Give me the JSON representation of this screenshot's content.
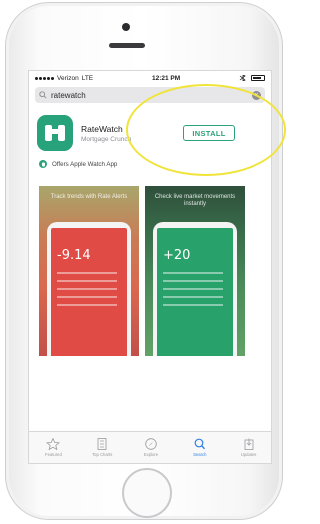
{
  "status_bar": {
    "carrier": "Verizon",
    "network": "LTE",
    "time": "12:21 PM"
  },
  "search": {
    "query": "ratewatch"
  },
  "app": {
    "name": "RateWatch",
    "category": "Mortgage Crunch",
    "install_label": "INSTALL",
    "brand_color": "#28a27a"
  },
  "watch_notice": "Offers Apple Watch App",
  "screenshots": [
    {
      "caption": "Track trends with Rate Alerts",
      "value": "-9.14",
      "color": "#e04b45"
    },
    {
      "caption": "Check live market movements instantly",
      "value": "+20",
      "color": "#29a16a"
    }
  ],
  "tab_bar": {
    "active_index": 3,
    "tabs": [
      {
        "label": "Featured",
        "icon": "star-icon"
      },
      {
        "label": "Top Charts",
        "icon": "list-icon"
      },
      {
        "label": "Explore",
        "icon": "compass-icon"
      },
      {
        "label": "Search",
        "icon": "search-icon"
      },
      {
        "label": "Updates",
        "icon": "download-icon"
      }
    ]
  },
  "annotation_color": "#f0e43a"
}
